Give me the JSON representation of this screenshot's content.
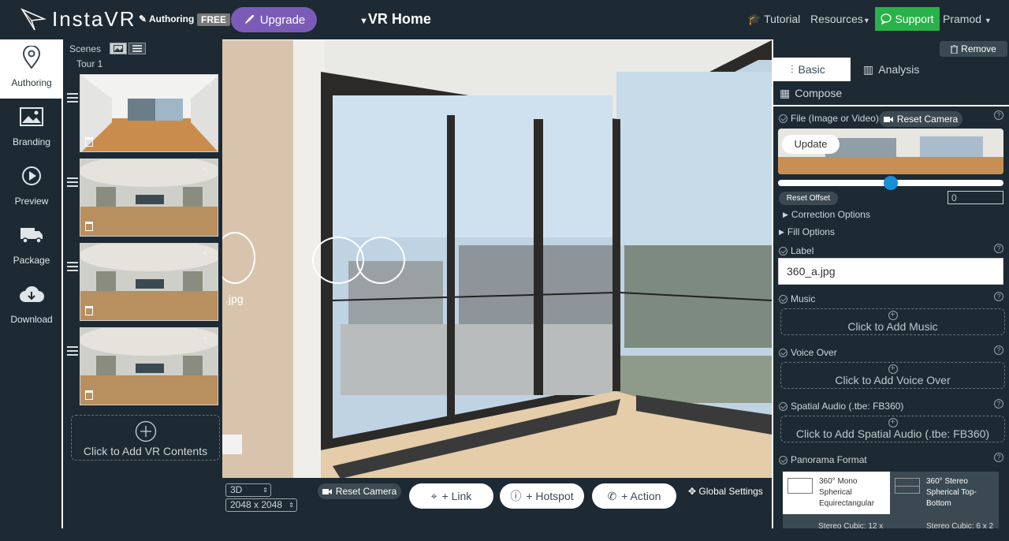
{
  "topbar": {
    "logo_text": "InstaVR",
    "authoring_tag": "Authoring",
    "free_badge": "FREE",
    "upgrade_label": "Upgrade",
    "project_title": "VR Home",
    "tutorial_label": "Tutorial",
    "resources_label": "Resources",
    "support_label": "Support",
    "user_label": "Pramod"
  },
  "leftnav": {
    "items": [
      {
        "label": "Authoring",
        "icon": "map-pin-icon"
      },
      {
        "label": "Branding",
        "icon": "image-icon"
      },
      {
        "label": "Preview",
        "icon": "play-icon"
      },
      {
        "label": "Package",
        "icon": "truck-icon"
      },
      {
        "label": "Download",
        "icon": "cloud-download-icon"
      }
    ]
  },
  "scenes": {
    "title": "Scenes",
    "tour_label": "Tour 1",
    "add_label": "Click to Add VR Contents"
  },
  "viewer": {
    "hotspot_label": ".jpg"
  },
  "bottombar": {
    "mode_select": "3D",
    "resolution_select": "2048 x 2048",
    "reset_camera": "Reset Camera",
    "link_label": "+ Link",
    "hotspot_label": "+ Hotspot",
    "action_label": "+ Action",
    "global_settings": "Global Settings"
  },
  "rightpanel": {
    "remove_label": "Remove",
    "tabs": [
      "Basic",
      "Analysis",
      "Compose"
    ],
    "file_label": "File (Image or Video)",
    "reset_camera": "Reset Camera",
    "update_label": "Update",
    "reset_offset": "Reset Offset",
    "offset_value": "0",
    "correction_options": "Correction Options",
    "fill_options": "Fill Options",
    "label_title": "Label",
    "label_value": "360_a.jpg",
    "music_title": "Music",
    "music_add": "Click to Add Music",
    "voiceover_title": "Voice Over",
    "voiceover_add": "Click to Add Voice Over",
    "spatial_title": "Spatial Audio (.tbe: FB360)",
    "spatial_add": "Click to Add Spatial Audio (.tbe: FB360)",
    "panorama_title": "Panorama Format",
    "formats": [
      "360° Mono Spherical Equirectangular",
      "360° Stereo Spherical Top-Bottom"
    ],
    "formats_partial": [
      "Stereo Cubic: 12 x",
      "Stereo Cubic: 6 x 2"
    ],
    "slider_fraction": 0.5
  },
  "colors": {
    "background": "#1d2a33",
    "upgrade": "#7b5bb8",
    "support": "#2ab24a",
    "slider": "#1a8fd6"
  }
}
